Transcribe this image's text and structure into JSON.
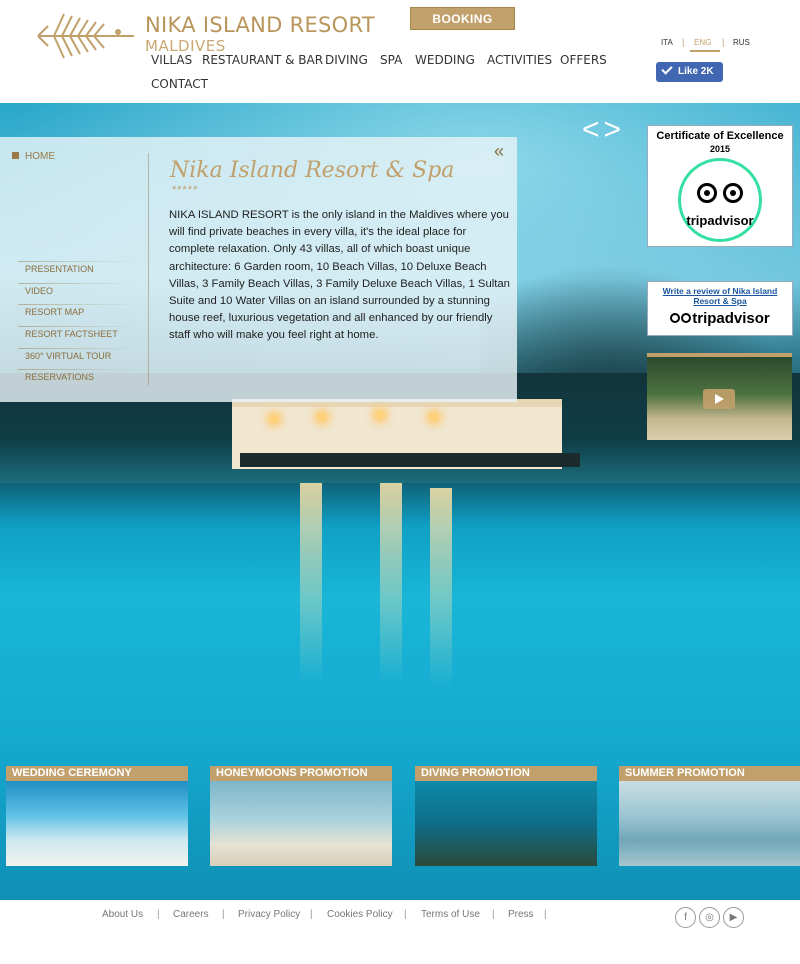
{
  "brand": {
    "name": "NIKA ISLAND RESORT",
    "sub": "MALDIVES"
  },
  "booking_label": "BOOKING",
  "nav": [
    "VILLAS",
    "RESTAURANT & BAR",
    "DIVING",
    "SPA",
    "WEDDING",
    "ACTIVITIES",
    "OFFERS",
    "CONTACT"
  ],
  "languages": [
    "ITA",
    "ENG",
    "RUS"
  ],
  "active_language": "ENG",
  "fb_like": "Like 2K",
  "breadcrumb_home": "HOME",
  "submenu": [
    "PRESENTATION",
    "VIDEO",
    "RESORT MAP",
    "RESORT FACTSHEET",
    "360° VIRTUAL TOUR",
    "RESERVATIONS"
  ],
  "resort": {
    "title": "Nika Island Resort & Spa",
    "stars": "*****",
    "description": "NIKA ISLAND RESORT is the only island in the Maldives where you will find private beaches in every villa, it's the ideal place for complete relaxation. Only 43 villas, all of which boast unique architecture: 6 Garden room, 10 Beach Villas, 10 Deluxe Beach Villas, 3 Family Beach Villas, 3 Family Deluxe Beach Villas, 1 Sultan Suite and 10 Water Villas on an island surrounded by a stunning house reef, luxurious vegetation and all enhanced by our friendly staff who will make you feel right at home."
  },
  "certificate": {
    "title": "Certificate of Excellence",
    "year": "2015",
    "logo_text": "tripadvisor"
  },
  "review": {
    "link": "Write a review of Nika Island Resort & Spa",
    "logo_text": "tripadvisor"
  },
  "promos": [
    "WEDDING CEREMONY",
    "HONEYMOONS PROMOTION",
    "DIVING PROMOTION",
    "SUMMER PROMOTION"
  ],
  "footer_links": [
    "About Us",
    "Careers",
    "Privacy Policy",
    "Cookies Policy",
    "Terms of Use",
    "Press"
  ],
  "social_icons": [
    "facebook-icon",
    "instagram-icon",
    "youtube-icon"
  ],
  "colors": {
    "accent": "#c2a06b",
    "facebook": "#4267b2",
    "tripadvisor_green": "#34e0a1"
  }
}
